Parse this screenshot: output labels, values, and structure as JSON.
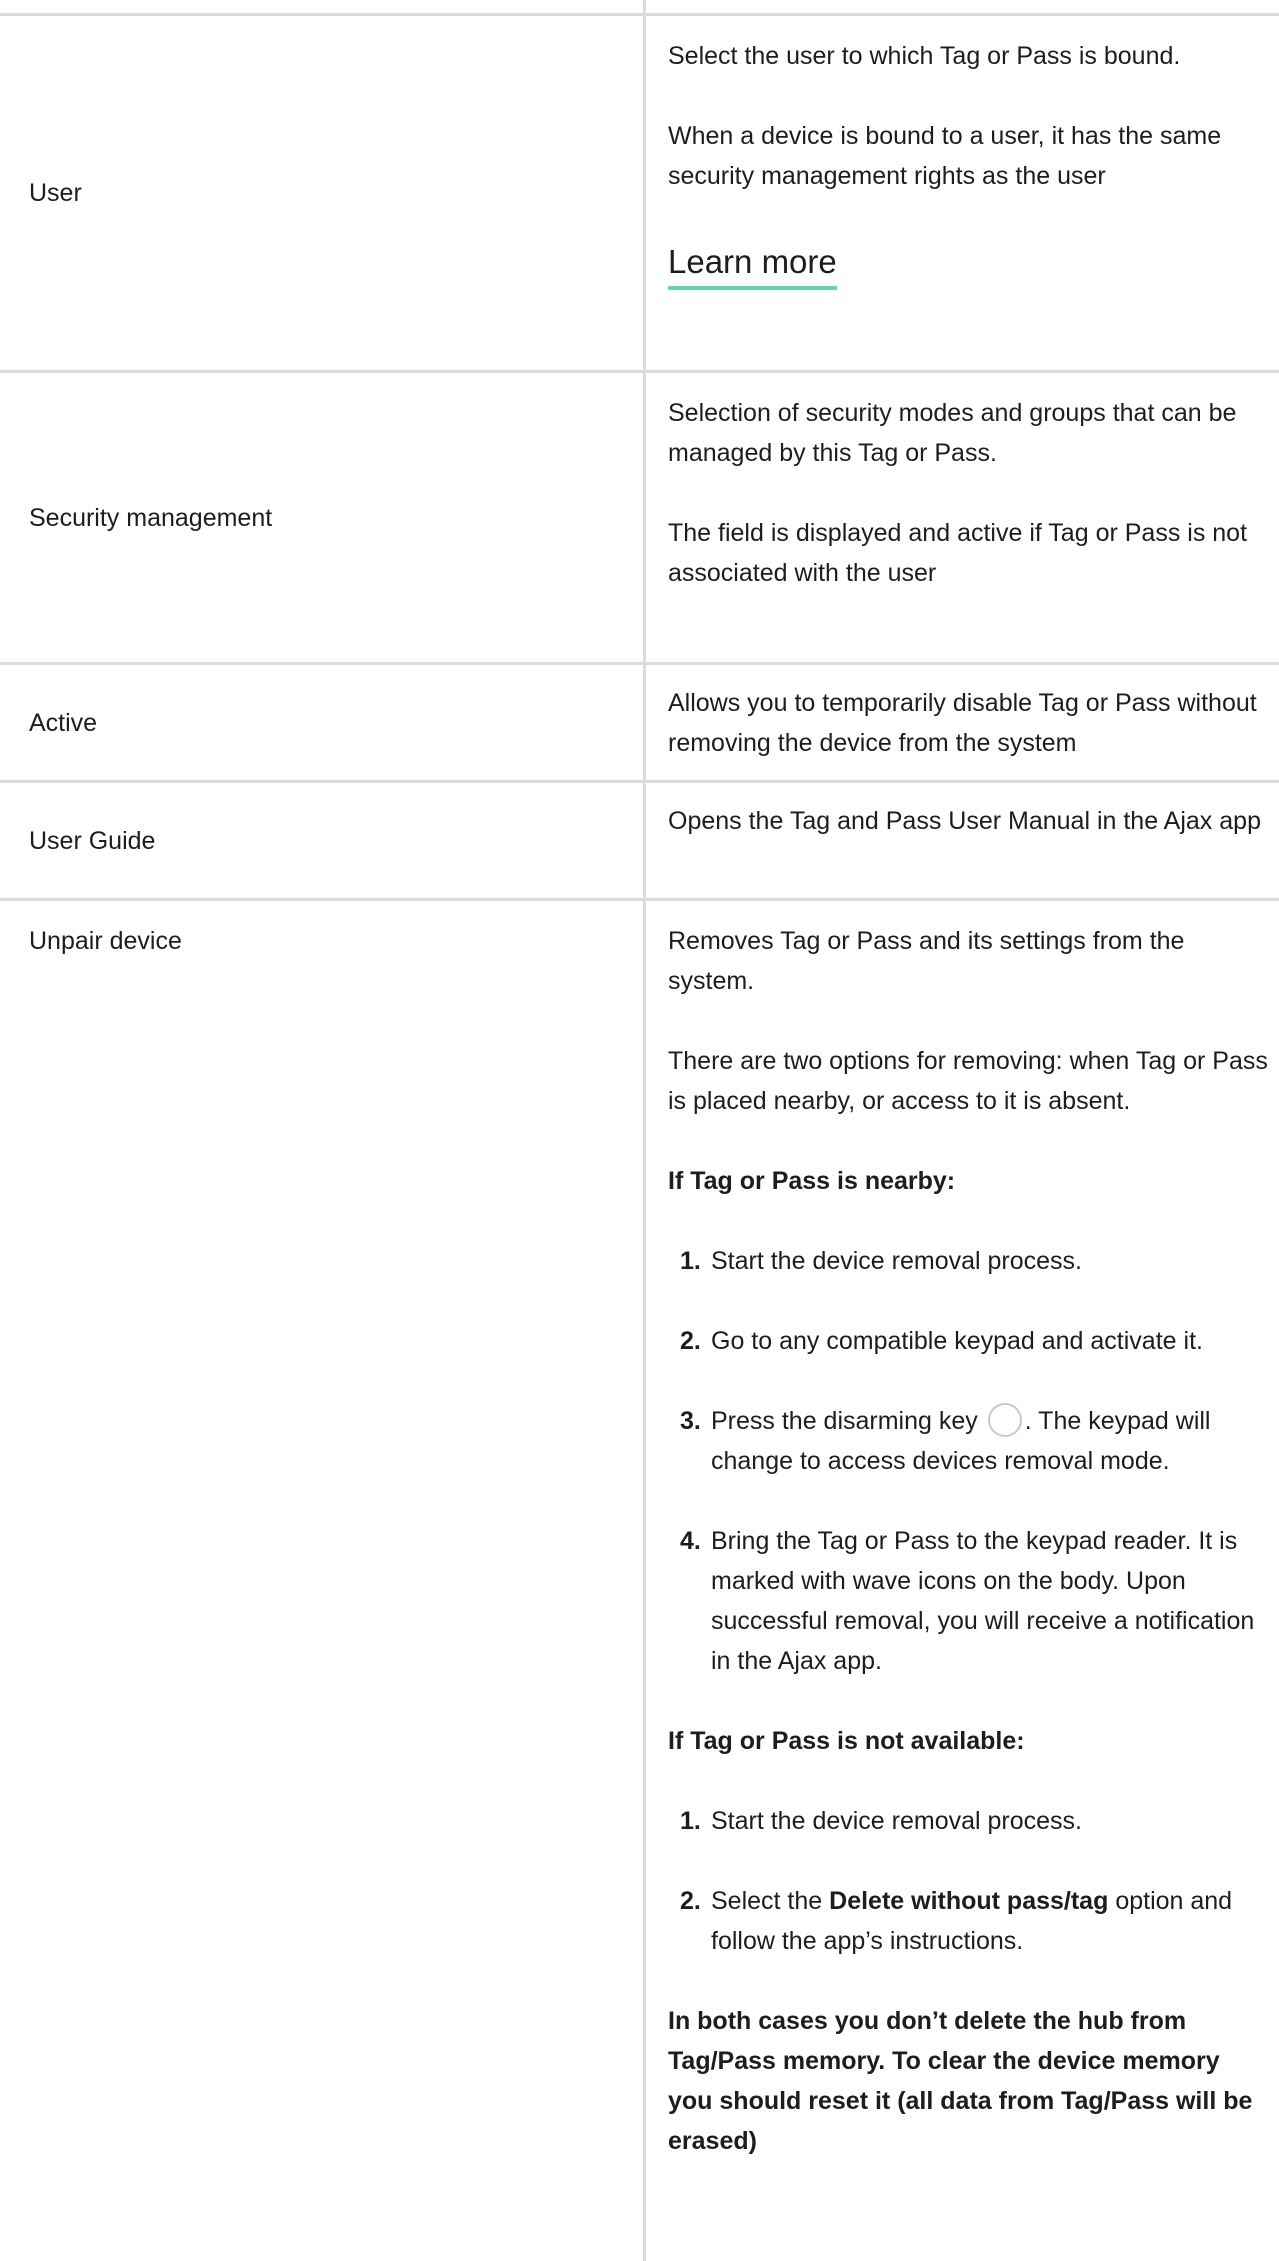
{
  "rows": {
    "user": {
      "name": "User",
      "desc1": "Select the user to which Tag or Pass is bound.",
      "desc2": "When a device is bound to a user, it has the same security management rights as the user",
      "learn_more": "Learn more"
    },
    "security": {
      "name": "Security management",
      "desc1": "Selection of security modes and groups that can be managed by this Tag or Pass.",
      "desc2": "The field is displayed and active if Tag or Pass is not associated with the user"
    },
    "active": {
      "name": "Active",
      "desc": "Allows you to temporarily disable Tag or Pass without removing the device from the system"
    },
    "guide": {
      "name": "User Guide",
      "desc": "Opens the Tag and Pass User Manual in the Ajax app"
    },
    "unpair": {
      "name": "Unpair device",
      "desc1": "Removes Tag or Pass and its settings from the system.",
      "desc2": "There are two options for removing: when Tag or Pass is placed nearby, or access to it is absent.",
      "nearby_heading": "If Tag or Pass is nearby:",
      "nearby_steps": [
        {
          "num": "1.",
          "text": "Start the device removal process."
        },
        {
          "num": "2.",
          "text": "Go to any compatible keypad and activate it."
        },
        {
          "num": "3.",
          "text_before": "Press the disarming key",
          "text_after": ". The keypad will change to access devices removal mode."
        },
        {
          "num": "4.",
          "text": "Bring the Tag or Pass to the keypad reader. It is marked with wave icons on the body. Upon successful removal, you will receive a notification in the Ajax app."
        }
      ],
      "unavailable_heading": "If Tag or Pass is not available:",
      "unavailable_steps": [
        {
          "num": "1.",
          "text": "Start the device removal process."
        },
        {
          "num": "2.",
          "text_before": "Select the",
          "bold": "Delete without pass/tag",
          "text_after": "option and follow the app’s instructions."
        }
      ],
      "note": "In both cases you don’t delete the hub from Tag/Pass memory. To clear the device memory you should reset it (all data from Tag/Pass will be erased)"
    }
  },
  "icons": {
    "disarm_key": "disarm-key-icon"
  },
  "colors": {
    "accent_underline": "#5ed8a5",
    "border": "#dcdcdc",
    "text": "#1d1d1d"
  }
}
